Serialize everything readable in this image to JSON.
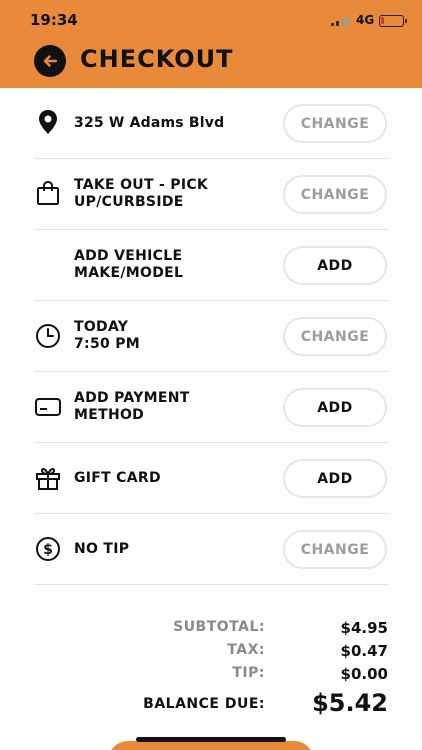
{
  "status_bar": {
    "time": "19:34",
    "network": "4G",
    "battery_level": 0.15,
    "battery_color": "#d33333"
  },
  "header": {
    "title": "CHECKOUT",
    "back_icon": "arrow-left-icon",
    "background": "#e98a3b"
  },
  "rows": [
    {
      "icon": "location-pin-icon",
      "label_lines": [
        "325 W Adams Blvd"
      ],
      "action": "CHANGE"
    },
    {
      "icon": "shopping-bag-icon",
      "label_lines": [
        "TAKE OUT - PICK",
        "UP/CURBSIDE"
      ],
      "action": "CHANGE"
    },
    {
      "icon": "",
      "label_lines": [
        "ADD VEHICLE",
        "MAKE/MODEL"
      ],
      "action": "ADD"
    },
    {
      "icon": "clock-icon",
      "label_lines": [
        "TODAY",
        "7:50 PM"
      ],
      "action": "CHANGE"
    },
    {
      "icon": "credit-card-icon",
      "label_lines": [
        "ADD PAYMENT",
        "METHOD"
      ],
      "action": "ADD"
    },
    {
      "icon": "gift-icon",
      "label_lines": [
        "GIFT CARD"
      ],
      "action": "ADD"
    },
    {
      "icon": "dollar-circle-icon",
      "label_lines": [
        "NO TIP"
      ],
      "action": "CHANGE"
    }
  ],
  "summary": {
    "subtotal_label": "SUBTOTAL:",
    "subtotal_value": "$4.95",
    "tax_label": "TAX:",
    "tax_value": "$0.47",
    "tip_label": "TIP:",
    "tip_value": "$0.00",
    "balance_label": "BALANCE DUE:",
    "balance_value": "$5.42"
  }
}
